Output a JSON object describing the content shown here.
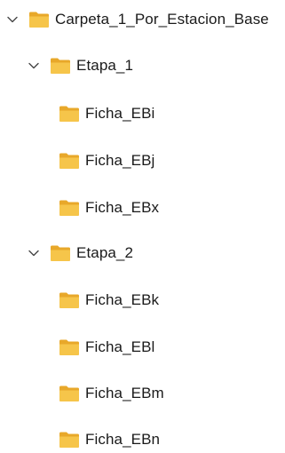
{
  "tree": {
    "root": {
      "label": "Carpeta_1_Por_Estacion_Base",
      "expanded": true,
      "icon": "folder-icon"
    },
    "stages": [
      {
        "label": "Etapa_1",
        "expanded": true,
        "icon": "folder-icon",
        "children": [
          {
            "label": "Ficha_EBi",
            "icon": "folder-icon"
          },
          {
            "label": "Ficha_EBj",
            "icon": "folder-icon"
          },
          {
            "label": "Ficha_EBx",
            "icon": "folder-icon"
          }
        ]
      },
      {
        "label": "Etapa_2",
        "expanded": true,
        "icon": "folder-icon",
        "children": [
          {
            "label": "Ficha_EBk",
            "icon": "folder-icon"
          },
          {
            "label": "Ficha_EBl",
            "icon": "folder-icon"
          },
          {
            "label": "Ficha_EBm",
            "icon": "folder-icon"
          },
          {
            "label": "Ficha_EBn",
            "icon": "folder-icon"
          }
        ]
      }
    ]
  },
  "colors": {
    "folder_back": "#e8a82a",
    "folder_front": "#f6c54a",
    "chevron": "#444444",
    "text": "#1a1a1a"
  }
}
